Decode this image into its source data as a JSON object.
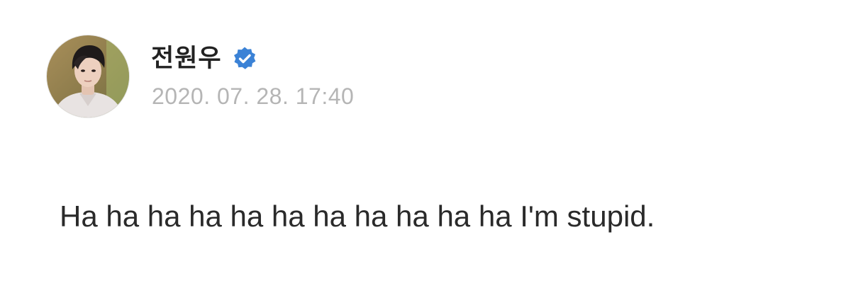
{
  "post": {
    "author_name": "전원우",
    "verified_icon": "verified-badge-icon",
    "timestamp": "2020. 07. 28. 17:40",
    "body": "Ha ha ha ha ha ha ha ha ha ha ha I'm stupid."
  },
  "colors": {
    "background": "#ffffff",
    "author_text": "#222222",
    "timestamp_text": "#b5b5b5",
    "body_text": "#2a2a2a",
    "verified_badge": "#3b82d6"
  }
}
